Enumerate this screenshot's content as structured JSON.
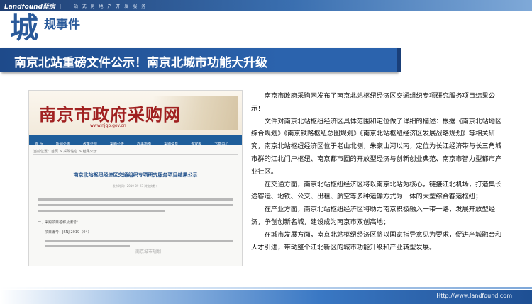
{
  "brand": {
    "logo": "Landfound蓝房",
    "slogan": "| 一 站 式 房 地 产 开 发 服 务"
  },
  "section": {
    "big_char": "城",
    "sub": "规事件"
  },
  "headline": "南京北站重磅文件公示！南京北城市功能大升级",
  "screenshot": {
    "site_title": "南京市政府采购网",
    "url": "www.njgp.gov.cn",
    "nav": [
      "首 页",
      "新闻公告",
      "政策法规",
      "采购公告",
      "办事指南",
      "采购信息",
      "专家库",
      "下载中心"
    ],
    "breadcrumb": "当前位置：首页 > 采购信息 > 结果公示",
    "doc_title": "南京北站枢纽经济区交通组织专项研究服务项目结果公示",
    "meta": "发布时间：2019-09-23 浏览次数：",
    "item1": "一、采购项目名称及编号：",
    "item2": "项目编号：JSNJ-2019（04）",
    "watermark": "南京城市规划"
  },
  "article": {
    "paragraphs": [
      "南京市政府采购网发布了南京北站枢纽经济区交通组织专项研究服务项目结果公示！",
      "文件对南京北站枢纽经济区具体范围和定位做了详细的描述：根据《南京北站地区综合规划》《南京铁路枢纽总图规划》《南京北站枢纽经济区发展战略规划》等相关研究，南京北站枢纽经济区位于老山北侧，朱家山河以南，定位为长江经济带与长三角城市群的江北门户枢纽、南京都市圈的开放型经济与创新创业典范、南京市智力型都市产业社区。",
      "在交通方面，南京北站枢纽经济区将以南京北站为核心，链接江北机场，打造集长途客运、地铁、公交、出租、航空等多种运输方式为一体的大型综合客运枢纽；",
      "在产业方面，南京北站枢纽经济区将助力南京积极融入一带一路，发展开放型经济，争创创新名城，建设成为南京市双创高地；",
      "在城市发展方面，南京北站枢纽经济区将以国家指导意见为要求，促进产城融合和人才引进，带动整个江北新区的城市功能升级和产业转型发展。"
    ]
  },
  "footer": {
    "url": "Http://www.landfound.com"
  }
}
